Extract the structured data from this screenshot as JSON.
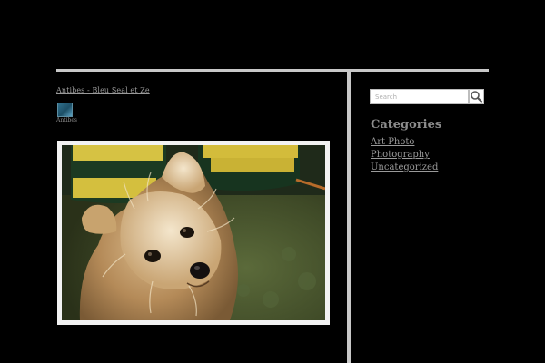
{
  "breadcrumb": {
    "text": "Antibes - Bleu Seal et Ze"
  },
  "thumbnail": {
    "caption": "Antibes"
  },
  "photo": {
    "subject": "dog-photo"
  },
  "search": {
    "placeholder": "Search"
  },
  "sidebar": {
    "categories_title": "Categories",
    "categories": [
      {
        "label": "Art Photo"
      },
      {
        "label": "Photography"
      },
      {
        "label": "Uncategorized"
      }
    ]
  },
  "colors": {
    "background": "#000000",
    "rule": "#c8c8c8",
    "frame": "#f2f2f2",
    "thumb": "#2f6f8c"
  }
}
